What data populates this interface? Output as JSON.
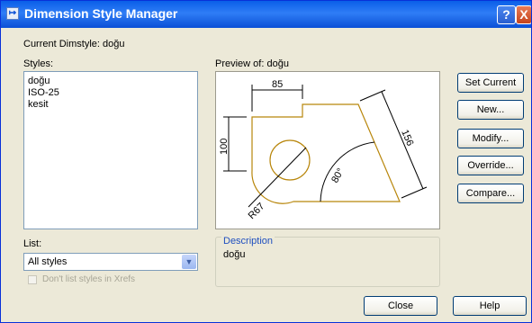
{
  "window": {
    "title": "Dimension Style Manager",
    "help_glyph": "?",
    "close_glyph": "X",
    "title_icon_glyph": "↦"
  },
  "current_dimstyle": "Current Dimstyle: doğu",
  "styles": {
    "label": "Styles:",
    "items": [
      "doğu",
      "ISO-25",
      "kesit"
    ]
  },
  "list": {
    "label": "List:",
    "value": "All styles",
    "arrow": "▼"
  },
  "dont_list": {
    "label": "Don't list styles in Xrefs"
  },
  "preview": {
    "label": "Preview of: doğu",
    "dims": {
      "top": "85",
      "left": "100",
      "diag": "156",
      "angle": "80°",
      "radius": "R67"
    },
    "line_color": "#b8860b",
    "dim_color": "#000000"
  },
  "description": {
    "title": "Description",
    "text": "doğu"
  },
  "buttons": {
    "set_current": "Set Current",
    "new": "New...",
    "modify": "Modify...",
    "override": "Override...",
    "compare": "Compare...",
    "close": "Close",
    "help": "Help"
  }
}
